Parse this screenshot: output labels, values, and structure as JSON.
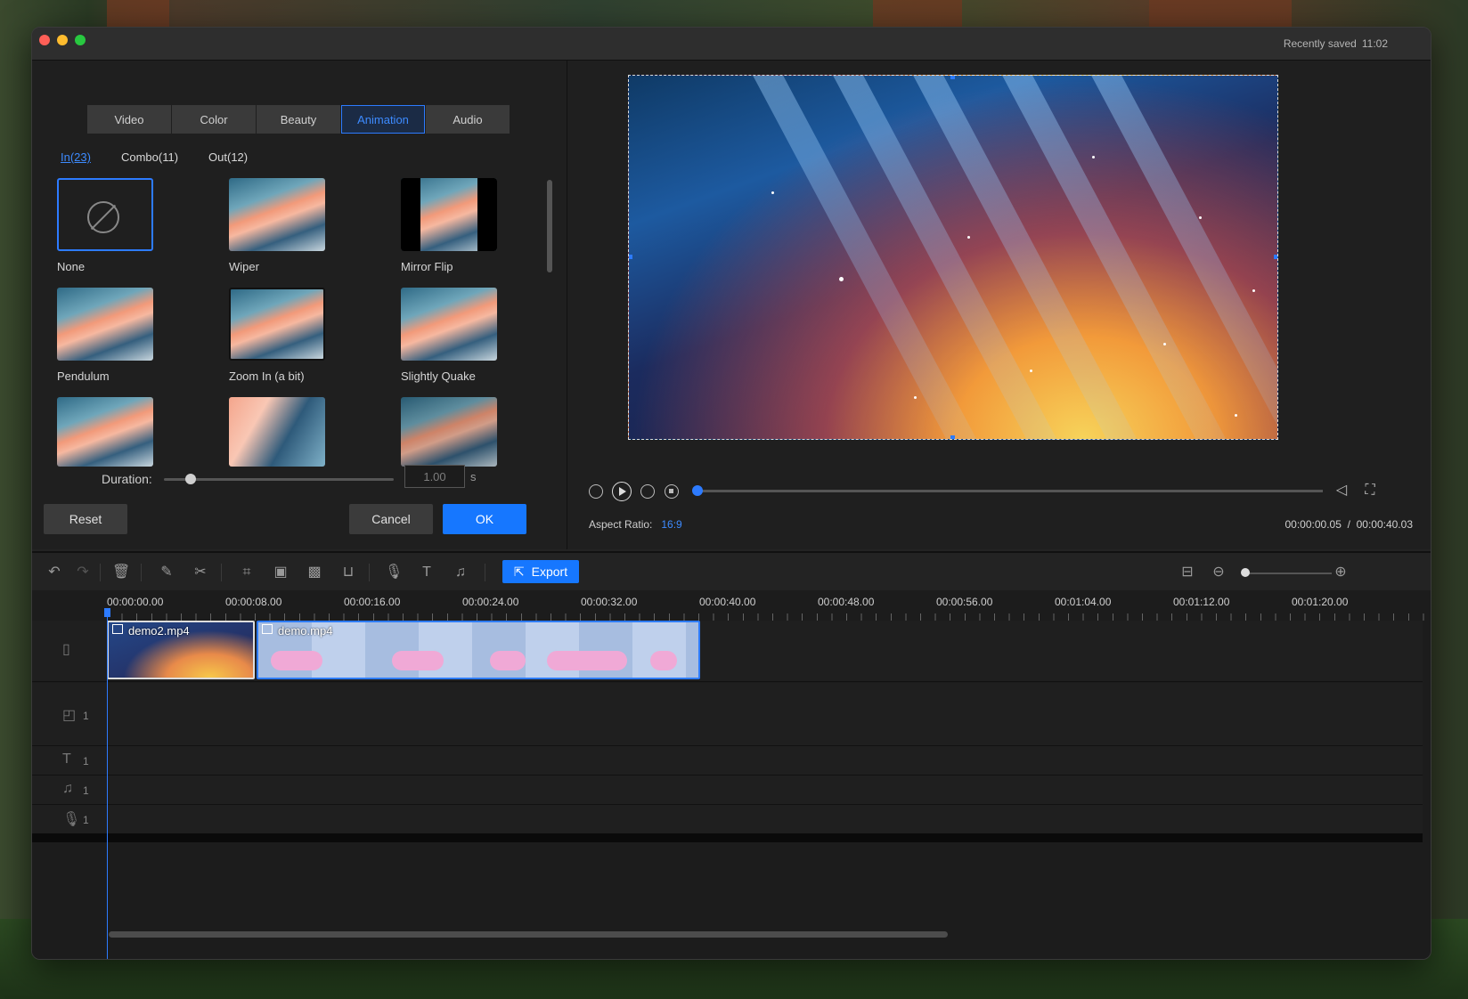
{
  "titlebar": {
    "status_label": "Recently saved",
    "status_time": "11:02"
  },
  "panel": {
    "tabs": [
      "Video",
      "Color",
      "Beauty",
      "Animation",
      "Audio"
    ],
    "active_tab": "Animation",
    "subtabs": [
      "In(23)",
      "Combo(11)",
      "Out(12)"
    ],
    "active_subtab": "In(23)",
    "effects": [
      "None",
      "Wiper",
      "Mirror Flip",
      "Pendulum",
      "Zoom In (a bit)",
      "Slightly Quake",
      "",
      "",
      ""
    ],
    "duration_label": "Duration:",
    "duration_value": "1.00",
    "duration_unit": "s",
    "reset_label": "Reset",
    "cancel_label": "Cancel",
    "ok_label": "OK"
  },
  "preview": {
    "aspect_label": "Aspect Ratio:",
    "aspect_value": "16:9",
    "current_time": "00:00:00.05",
    "time_separator": "/",
    "total_time": "00:00:40.03"
  },
  "toolbar": {
    "export_label": "Export"
  },
  "timeline": {
    "ruler": [
      "00:00:00.00",
      "00:00:08.00",
      "00:00:16.00",
      "00:00:24.00",
      "00:00:32.00",
      "00:00:40.00",
      "00:00:48.00",
      "00:00:56.00",
      "00:01:04.00",
      "00:01:12.00",
      "00:01:20.00"
    ],
    "clips": [
      "demo2.mp4",
      "demo.mp4"
    ],
    "track_counts": [
      "1",
      "1",
      "1",
      "1"
    ]
  },
  "colors": {
    "accent": "#1677ff",
    "selected_border": "#2d7bff",
    "window_bg": "#232323"
  }
}
